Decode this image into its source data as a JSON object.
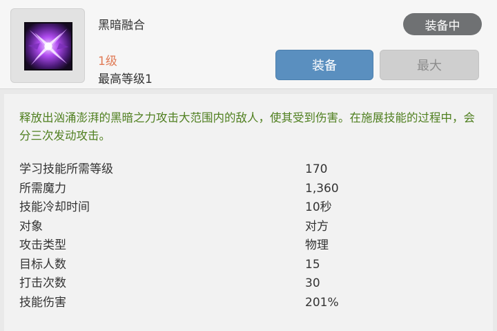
{
  "skill": {
    "name": "黑暗融合",
    "level": "1级",
    "max_level": "最高等级1",
    "icon": "dark-fusion-skill-icon"
  },
  "badge": {
    "label": "装备中"
  },
  "buttons": {
    "equip_label": "装备",
    "max_label": "最大"
  },
  "description": "释放出汹涌澎湃的黑暗之力攻击大范围内的敌人，使其受到伤害。在施展技能的过程中，会分三次发动攻击。",
  "stats": [
    {
      "label": "学习技能所需等级",
      "value": "170"
    },
    {
      "label": "所需魔力",
      "value": "1,360"
    },
    {
      "label": "技能冷却时间",
      "value": "10秒"
    },
    {
      "label": "对象",
      "value": "对方"
    },
    {
      "label": "攻击类型",
      "value": "物理"
    },
    {
      "label": "目标人数",
      "value": "15"
    },
    {
      "label": "打击次数",
      "value": "30"
    },
    {
      "label": "技能伤害",
      "value": "201%"
    }
  ],
  "colors": {
    "level_text": "#e07a55",
    "description_text": "#4f7f1f",
    "equip_button": "#5a8fbf",
    "max_button": "#cfcfcf",
    "badge": "#6f7173"
  }
}
